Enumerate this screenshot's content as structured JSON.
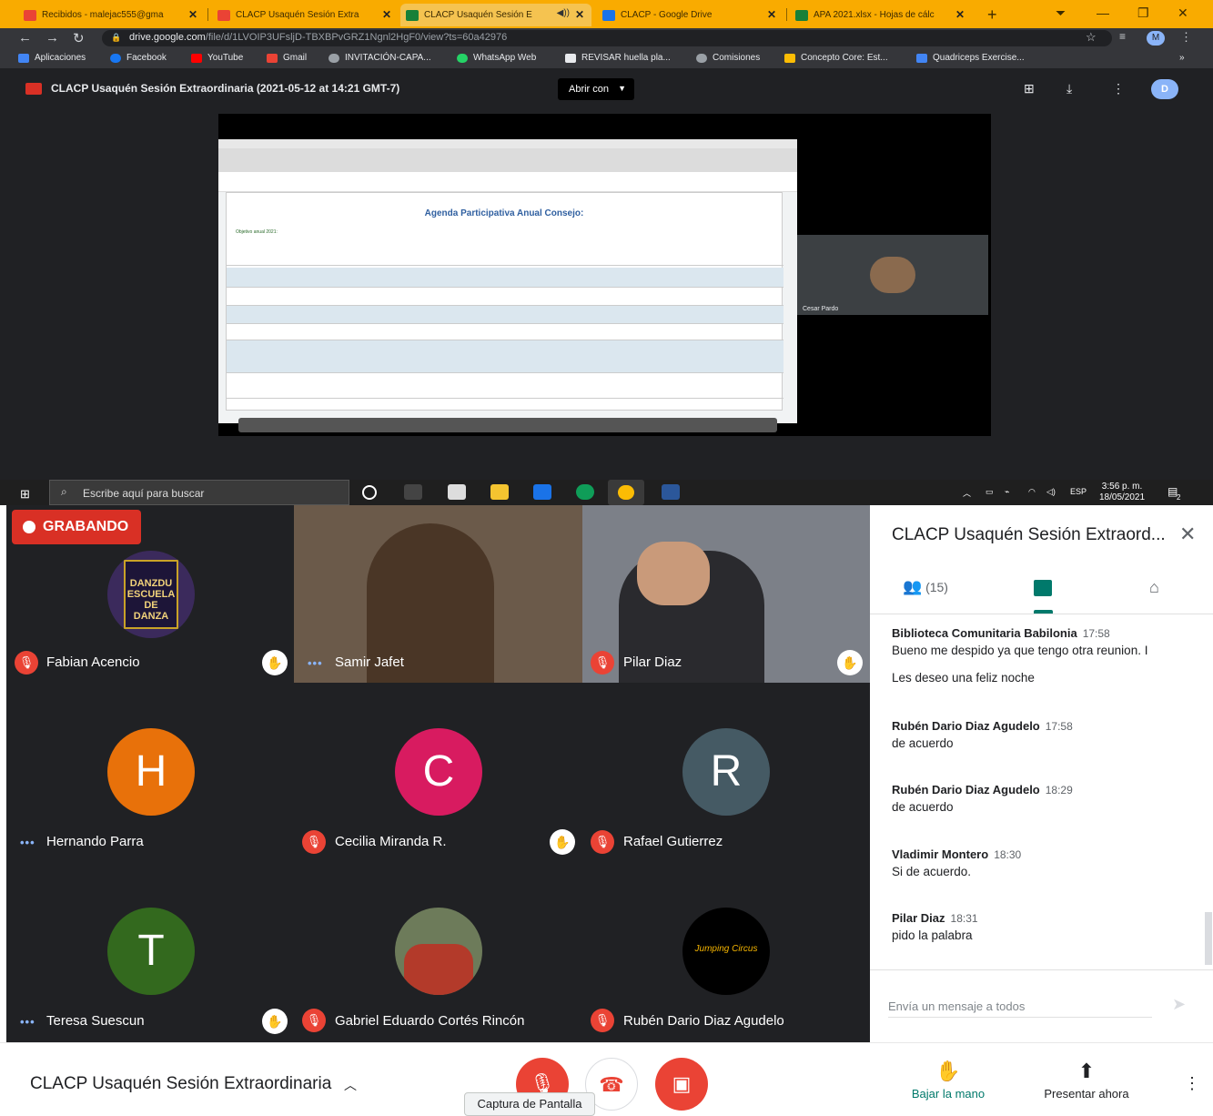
{
  "browser": {
    "tabs": [
      {
        "label": "Recibidos - malejac555@gma",
        "color": "#ea4335"
      },
      {
        "label": "CLACP Usaquén Sesión Extra",
        "color": "#ea4335"
      },
      {
        "label": "CLACP Usaquén Sesión E",
        "color": "#188038"
      },
      {
        "label": "CLACP - Google Drive",
        "color": "#1a73e8"
      },
      {
        "label": "APA 2021.xlsx - Hojas de cálc",
        "color": "#188038"
      }
    ],
    "url_host": "drive.google.com",
    "url_path": "/file/d/1LVOIP3UFsljD-TBXBPvGRZ1Ngnl2HgF0/view?ts=60a42976",
    "profile_initial": "M",
    "bookmarks": [
      "Aplicaciones",
      "Facebook",
      "YouTube",
      "Gmail",
      "INVITACIÓN-CAPA...",
      "WhatsApp Web",
      "REVISAR huella pla...",
      "Comisiones",
      "Concepto Core: Est...",
      "Quadriceps Exercise..."
    ]
  },
  "viewer": {
    "title": "CLACP Usaquén Sesión Extraordinaria (2021-05-12 at 14:21 GMT-7)",
    "open_with": "Abrir con",
    "avatar_initial": "D",
    "sheet_title": "Agenda Participativa Anual Consejo:",
    "sheet_objective": "Objetivo anual 2021:",
    "side_participant": "Cesar Pardo"
  },
  "taskbar": {
    "search_placeholder": "Escribe aquí para buscar",
    "lang": "ESP",
    "time": "3:56 p. m.",
    "date": "18/05/2021",
    "notifications": "2"
  },
  "meet": {
    "recording_label": "GRABANDO",
    "logo_text": "DANZDU ESCUELA DE DANZA",
    "participants": [
      {
        "name": "Fabian Acencio"
      },
      {
        "name": "Samir Jafet"
      },
      {
        "name": "Pilar Diaz"
      },
      {
        "name": "Hernando Parra",
        "initial": "H",
        "color": "#e8710a"
      },
      {
        "name": "Cecilia Miranda R.",
        "initial": "C",
        "color": "#d81b60"
      },
      {
        "name": "Rafael Gutierrez",
        "initial": "R",
        "color": "#455a64"
      },
      {
        "name": "Teresa Suescun",
        "initial": "T",
        "color": "#33691e"
      },
      {
        "name": "Gabriel Eduardo Cortés Rincón"
      },
      {
        "name": "Rubén Dario Diaz Agudelo"
      }
    ],
    "jumping_logo": "Jumping Circus"
  },
  "panel": {
    "title": "CLACP Usaquén Sesión Extraord...",
    "people_count": "(15)",
    "messages": [
      {
        "sender": "Biblioteca Comunitaria Babilonia",
        "time": "17:58",
        "text": "Bueno me despido ya que tengo otra reunion. I",
        "text2": "Les deseo una feliz noche"
      },
      {
        "sender": "Rubén Dario Diaz Agudelo",
        "time": "17:58",
        "text": "de acuerdo"
      },
      {
        "sender": "Rubén Dario Diaz Agudelo",
        "time": "18:29",
        "text": "de acuerdo"
      },
      {
        "sender": "Vladimir Montero",
        "time": "18:30",
        "text": "Si de acuerdo."
      },
      {
        "sender": "Pilar Diaz",
        "time": "18:31",
        "text": "pido la palabra"
      }
    ],
    "input_placeholder": "Envía un mensaje a todos"
  },
  "bottom": {
    "meeting_name": "CLACP Usaquén Sesión Extraordinaria",
    "tooltip": "Captura de Pantalla",
    "lower_hand": "Bajar la mano",
    "present_now": "Presentar ahora"
  }
}
